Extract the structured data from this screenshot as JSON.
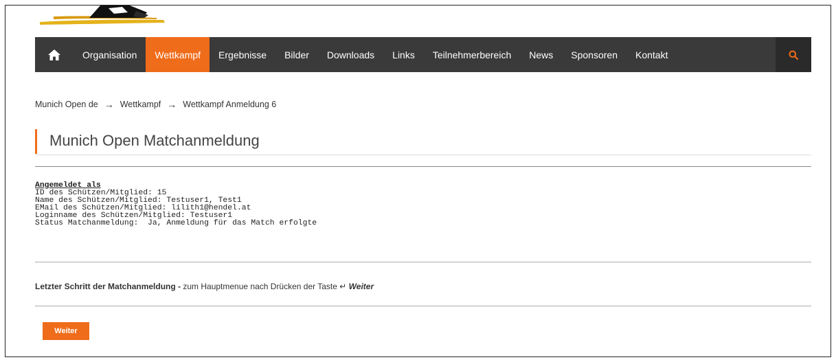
{
  "nav": {
    "items": [
      {
        "label": "Organisation"
      },
      {
        "label": "Wettkampf"
      },
      {
        "label": "Ergebnisse"
      },
      {
        "label": "Bilder"
      },
      {
        "label": "Downloads"
      },
      {
        "label": "Links"
      },
      {
        "label": "Teilnehmerbereich"
      },
      {
        "label": "News"
      },
      {
        "label": "Sponsoren"
      },
      {
        "label": "Kontakt"
      }
    ],
    "active": "Wettkampf",
    "home_icon": "home-icon",
    "search_icon": "search-icon"
  },
  "breadcrumb": {
    "items": [
      "Munich Open de",
      "Wettkampf",
      "Wettkampf Anmeldung 6"
    ],
    "separator": "→"
  },
  "page": {
    "title": "Munich Open Matchanmeldung"
  },
  "info": {
    "heading": "Angemeldet als",
    "lines": [
      "ID des Schützen/Mitglied: 15",
      "Name des Schützen/Mitglied: Testuser1, Test1",
      "EMail des Schützen/Mitglied: lilith1@hendel.at",
      "Loginname des Schützen/Mitglied: Testuser1",
      "Status Matchanmeldung:  Ja, Anmeldung für das Match erfolgte"
    ]
  },
  "instruction": {
    "strong": "Letzter Schritt der Matchanmeldung -",
    "text": " zum Hauptmenue nach Drücken der Taste ",
    "enter_symbol": "↵",
    "key": "Weiter"
  },
  "button": {
    "weiter": "Weiter"
  },
  "colors": {
    "accent": "#ef6c1a",
    "navbar": "#3a3a3a",
    "search_bg": "#2a2a2a"
  }
}
